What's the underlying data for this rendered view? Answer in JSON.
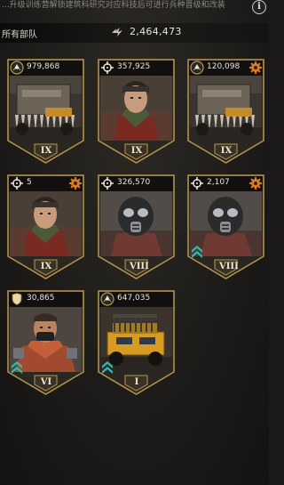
{
  "top_hint": "...升级训练营解锁建筑科研究对应科技后可进行兵种晋级和改装",
  "header": {
    "label": "所有部队",
    "power": "2,464,473"
  },
  "colors": {
    "gold": "#b9974f",
    "accent_orange": "#e07a1f",
    "teal": "#2dbbb0"
  },
  "units": [
    {
      "type_icon": "tank-icon",
      "count": "979,868",
      "rank": "IX",
      "has_gear": false,
      "has_chevron": false,
      "art": "harvester"
    },
    {
      "type_icon": "crosshair-icon",
      "count": "357,925",
      "rank": "IX",
      "has_gear": false,
      "has_chevron": false,
      "art": "soldier"
    },
    {
      "type_icon": "tank-icon",
      "count": "120,098",
      "rank": "IX",
      "has_gear": true,
      "has_chevron": false,
      "art": "harvester"
    },
    {
      "type_icon": "crosshair-icon",
      "count": "5",
      "rank": "IX",
      "has_gear": true,
      "has_chevron": false,
      "art": "soldier"
    },
    {
      "type_icon": "crosshair-icon",
      "count": "326,570",
      "rank": "VIII",
      "has_gear": false,
      "has_chevron": false,
      "art": "gasmask"
    },
    {
      "type_icon": "crosshair-icon",
      "count": "2,107",
      "rank": "VIII",
      "has_gear": true,
      "has_chevron": true,
      "art": "gasmask"
    },
    {
      "type_icon": "shield-icon",
      "count": "30,865",
      "rank": "VI",
      "has_gear": false,
      "has_chevron": true,
      "art": "brawler"
    },
    {
      "type_icon": "tank-icon",
      "count": "647,035",
      "rank": "I",
      "has_gear": false,
      "has_chevron": true,
      "art": "vehicle"
    }
  ]
}
